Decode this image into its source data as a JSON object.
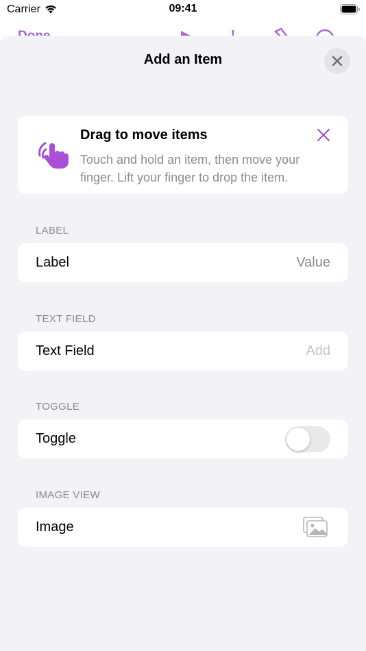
{
  "status_bar": {
    "carrier": "Carrier",
    "time": "09:41"
  },
  "behind": {
    "done_label": "Done"
  },
  "sheet": {
    "title": "Add an Item"
  },
  "tip": {
    "title": "Drag to move items",
    "body": "Touch and hold an item, then move your finger. Lift your finger to drop the item."
  },
  "sections": {
    "label": {
      "header": "LABEL",
      "row_label": "Label",
      "value": "Value"
    },
    "text_field": {
      "header": "TEXT FIELD",
      "row_label": "Text Field",
      "value": "",
      "placeholder": "Add"
    },
    "toggle": {
      "header": "TOGGLE",
      "row_label": "Toggle",
      "on": false
    },
    "image_view": {
      "header": "IMAGE VIEW",
      "row_label": "Image",
      "icon": "photo-stack-icon"
    }
  },
  "colors": {
    "accent": "#9b4fd0",
    "sheet_bg": "#f2f2f7",
    "secondary_text": "#8a8a8e",
    "toggle_off": "#e9e9ea"
  }
}
